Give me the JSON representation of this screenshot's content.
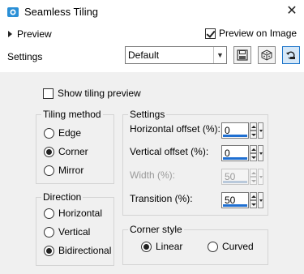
{
  "window": {
    "title": "Seamless Tiling"
  },
  "preview": {
    "label": "Preview",
    "on_image_label": "Preview on Image",
    "on_image_checked": true
  },
  "settings": {
    "label": "Settings",
    "preset_value": "Default"
  },
  "toolbar": {
    "icons": [
      "save-preset-icon",
      "randomize-icon",
      "reset-icon"
    ]
  },
  "show_tiling_preview": {
    "label": "Show tiling preview",
    "checked": false
  },
  "tiling_method": {
    "legend": "Tiling method",
    "options": [
      {
        "label": "Edge",
        "checked": false
      },
      {
        "label": "Corner",
        "checked": true
      },
      {
        "label": "Mirror",
        "checked": false
      }
    ]
  },
  "direction": {
    "legend": "Direction",
    "options": [
      {
        "label": "Horizontal",
        "checked": false
      },
      {
        "label": "Vertical",
        "checked": false
      },
      {
        "label": "Bidirectional",
        "checked": true
      }
    ]
  },
  "settings_group": {
    "legend": "Settings",
    "fields": [
      {
        "label": "Horizontal offset (%):",
        "value": "0",
        "enabled": true
      },
      {
        "label": "Vertical offset (%):",
        "value": "0",
        "enabled": true
      },
      {
        "label": "Width (%):",
        "value": "50",
        "enabled": false
      },
      {
        "label": "Transition (%):",
        "value": "50",
        "enabled": true
      }
    ]
  },
  "corner_style": {
    "legend": "Corner style",
    "options": [
      {
        "label": "Linear",
        "checked": true
      },
      {
        "label": "Curved",
        "checked": false
      }
    ]
  },
  "colors": {
    "accent": "#1f6fd1",
    "panel_bg": "#f0f0f0"
  }
}
